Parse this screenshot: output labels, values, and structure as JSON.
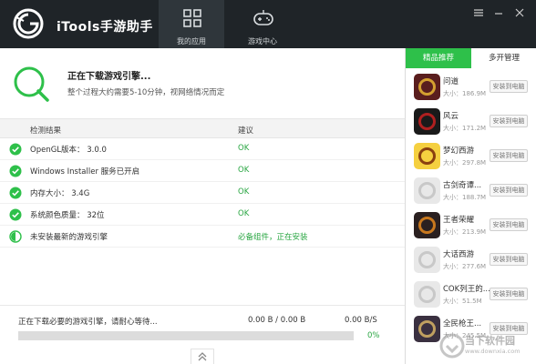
{
  "app": {
    "title": "iTools手游助手"
  },
  "nav": [
    {
      "label": "我的应用",
      "icon": "grid-apps-icon",
      "active": true
    },
    {
      "label": "游戏中心",
      "icon": "gamepad-icon",
      "active": false
    }
  ],
  "download": {
    "title": "正在下载游戏引擎...",
    "subtitle": "整个过程大约需要5-10分钟，视网络情况而定"
  },
  "table": {
    "header_item": "检测结果",
    "header_result": "建议",
    "rows": [
      {
        "item": "OpenGL版本： 3.0.0",
        "result": "OK",
        "icon": "check-circle-icon"
      },
      {
        "item": "Windows Installer 服务已开启",
        "result": "OK",
        "icon": "check-circle-icon"
      },
      {
        "item": "内存大小： 3.4G",
        "result": "OK",
        "icon": "check-circle-icon"
      },
      {
        "item": "系统颜色质量： 32位",
        "result": "OK",
        "icon": "check-circle-icon"
      },
      {
        "item": "未安装最新的游戏引擎",
        "result": "必备组件，正在安装",
        "icon": "half-circle-icon"
      }
    ]
  },
  "status": {
    "text": "正在下载必要的游戏引擎，请耐心等待...",
    "size": "0.00 B / 0.00 B",
    "speed": "0.00 B/S",
    "percent_label": "0%",
    "progress": 0.0
  },
  "sidebar": {
    "tabs": [
      "精品推荐",
      "多开管理"
    ],
    "size_prefix": "大小：",
    "install_label": "安装到电脑",
    "apps": [
      {
        "name": "问道",
        "size": "186.9M"
      },
      {
        "name": "风云",
        "size": "171.2M"
      },
      {
        "name": "梦幻西游",
        "size": "297.8M"
      },
      {
        "name": "古剑奇谭...",
        "size": "188.7M"
      },
      {
        "name": "王者荣耀",
        "size": "213.9M"
      },
      {
        "name": "大话西游",
        "size": "277.6M"
      },
      {
        "name": "COK列王的...",
        "size": "51.5M"
      },
      {
        "name": "全民枪王...",
        "size": "245.5M"
      }
    ]
  },
  "watermark": {
    "text": "当下软件园",
    "url": "www.downxia.com"
  },
  "colors": {
    "accent": "#2ec04a",
    "titlebar": "#1f2428",
    "ok": "#29a642"
  }
}
